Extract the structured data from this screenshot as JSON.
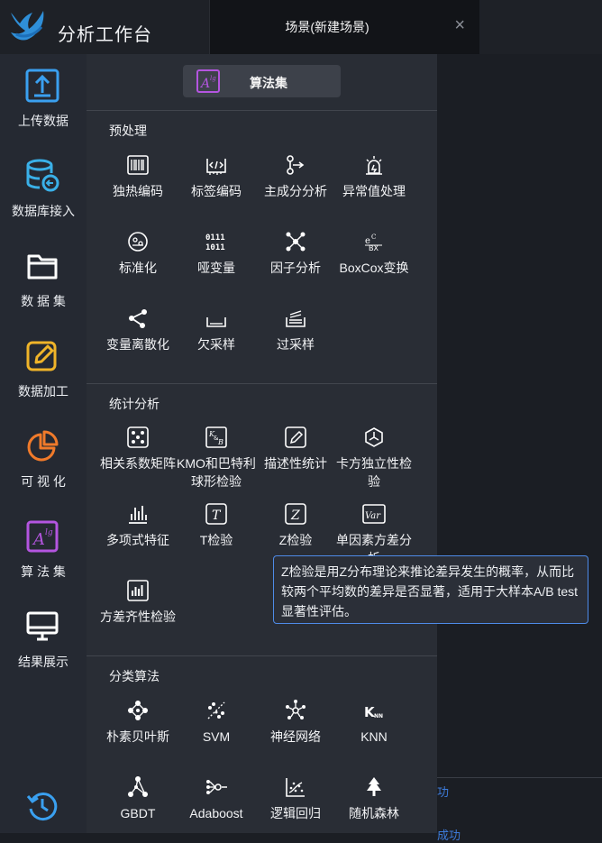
{
  "app": {
    "title": "分析工作台"
  },
  "tab": {
    "title": "场景(新建场景)",
    "close": "×"
  },
  "sidebar": {
    "items": [
      {
        "label": "上传数据",
        "icon": "upload-icon",
        "color": "#3aa0f0"
      },
      {
        "label": "数据库接入",
        "icon": "database-icon",
        "color": "#3ab0e8"
      },
      {
        "label": "数 据 集",
        "icon": "folder-icon",
        "color": "#ffffff"
      },
      {
        "label": "数据加工",
        "icon": "edit-icon",
        "color": "#f0b429"
      },
      {
        "label": "可 视 化",
        "icon": "pie-chart-icon",
        "color": "#f07a2a"
      },
      {
        "label": "算 法 集",
        "icon": "algorithm-icon",
        "color": "#b455e0"
      },
      {
        "label": "结果展示",
        "icon": "monitor-icon",
        "color": "#ffffff"
      }
    ],
    "bottom_icon": "history-icon"
  },
  "panel": {
    "header_button": "算法集",
    "sections": [
      {
        "title": "预处理",
        "items": [
          "独热编码",
          "标签编码",
          "主成分分析",
          "异常值处理",
          "标准化",
          "哑变量",
          "因子分析",
          "BoxCox变换",
          "变量离散化",
          "欠采样",
          "过采样"
        ]
      },
      {
        "title": "统计分析",
        "items": [
          "相关系数矩阵",
          "KMO和巴特利球形检验",
          "描述性统计",
          "卡方独立性检验",
          "多项式特征",
          "T检验",
          "Z检验",
          "单因素方差分析",
          "方差齐性检验"
        ]
      },
      {
        "title": "分类算法",
        "items": [
          "朴素贝叶斯",
          "SVM",
          "神经网络",
          "KNN",
          "GBDT",
          "Adaboost",
          "逻辑回归",
          "随机森林"
        ]
      }
    ]
  },
  "tooltip": {
    "text": "Z检验是用Z分布理论来推论差异发生的概率，从而比较两个平均数的差异是否显著，适用于大样本A/B test显著性评估。"
  },
  "main": {
    "fragment1": "功",
    "fragment2": "成功"
  },
  "colors": {
    "accent": "#4e8be8",
    "panel": "#292d35",
    "sidebar": "#252932",
    "purple": "#b455e0"
  }
}
